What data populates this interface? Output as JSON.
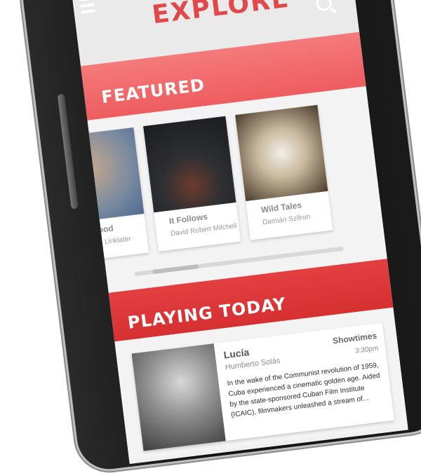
{
  "header": {
    "title": "EXPLORE"
  },
  "featured": {
    "heading": "FEATURED",
    "cards": [
      {
        "title": "Boyhood",
        "subtitle": "Richard Linklater"
      },
      {
        "title": "It Follows",
        "subtitle": "David Robert Mitchell"
      },
      {
        "title": "Wild Tales",
        "subtitle": "Damián Szifron"
      }
    ]
  },
  "playing_today": {
    "heading": "PLAYING TODAY",
    "movie": {
      "title": "Lucía",
      "director": "Humberto Solás",
      "showtimes_label": "Showtimes",
      "time": "3:30pm",
      "description": "In the wake of the Communist revolution of 1959, Cuba experienced a cinematic golden age. Aided by the state-sponsored Cuban Film Institute (ICAIC), filmmakers unleashed a stream of..."
    }
  },
  "colors": {
    "accent": "#e0484a",
    "featured_band": "#f06a6c",
    "playing_band": "#d63031"
  },
  "icons": {
    "menu": "menu-icon",
    "search": "search-icon"
  }
}
